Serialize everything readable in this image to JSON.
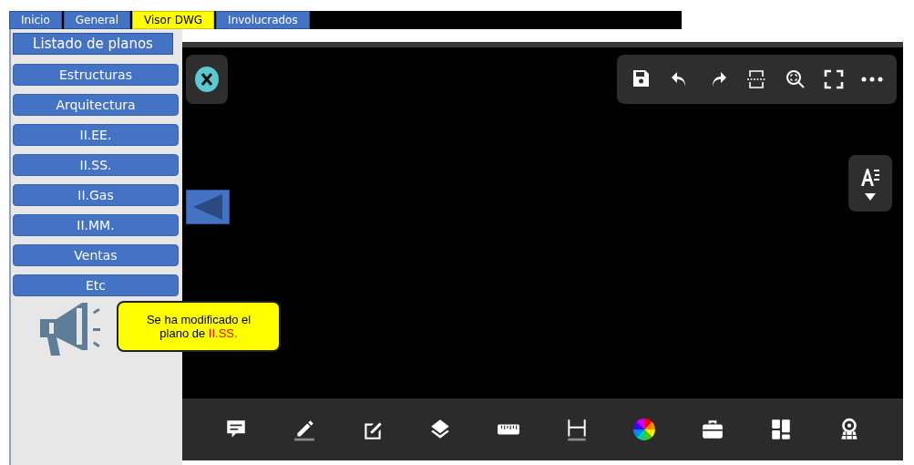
{
  "tabs": [
    {
      "label": "Inicio",
      "selected": false
    },
    {
      "label": "General",
      "selected": false
    },
    {
      "label": "Visor DWG",
      "selected": true
    },
    {
      "label": "Involucrados",
      "selected": false
    }
  ],
  "sidebar": {
    "title": "Listado de planos",
    "plans": [
      "Estructuras",
      "Arquitectura",
      "II.EE.",
      "II.SS.",
      "II.Gas",
      "II.MM.",
      "Ventas",
      "Etc"
    ]
  },
  "notification": {
    "text": "Se ha modificado el plano de ",
    "highlight": "II.SS."
  }
}
